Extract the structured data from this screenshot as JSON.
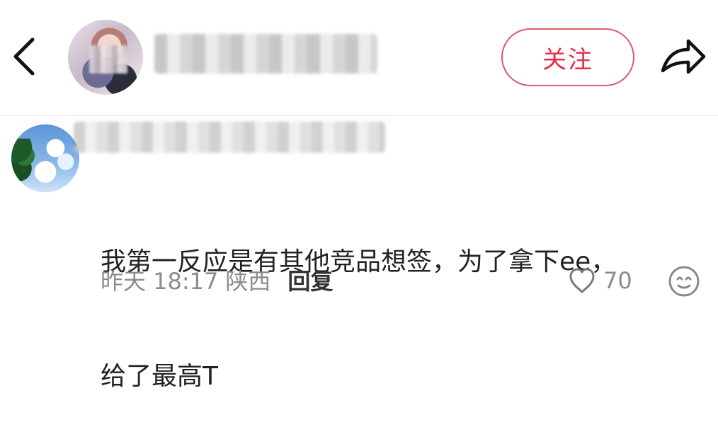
{
  "header": {
    "follow_label": "关注",
    "icons": {
      "back": "back-chevron-icon",
      "share": "share-arrow-icon"
    }
  },
  "comment": {
    "text_line1": "我第一反应是有其他竞品想签，为了拿下ee，",
    "text_line2": "给了最高T",
    "time": "昨天 18:17",
    "location": "陕西",
    "reply_label": "回复",
    "like_count": "70"
  },
  "colors": {
    "accent": "#e0314b",
    "follow_border": "#d65a6f",
    "text": "#222222",
    "muted": "#8c8c8c"
  }
}
